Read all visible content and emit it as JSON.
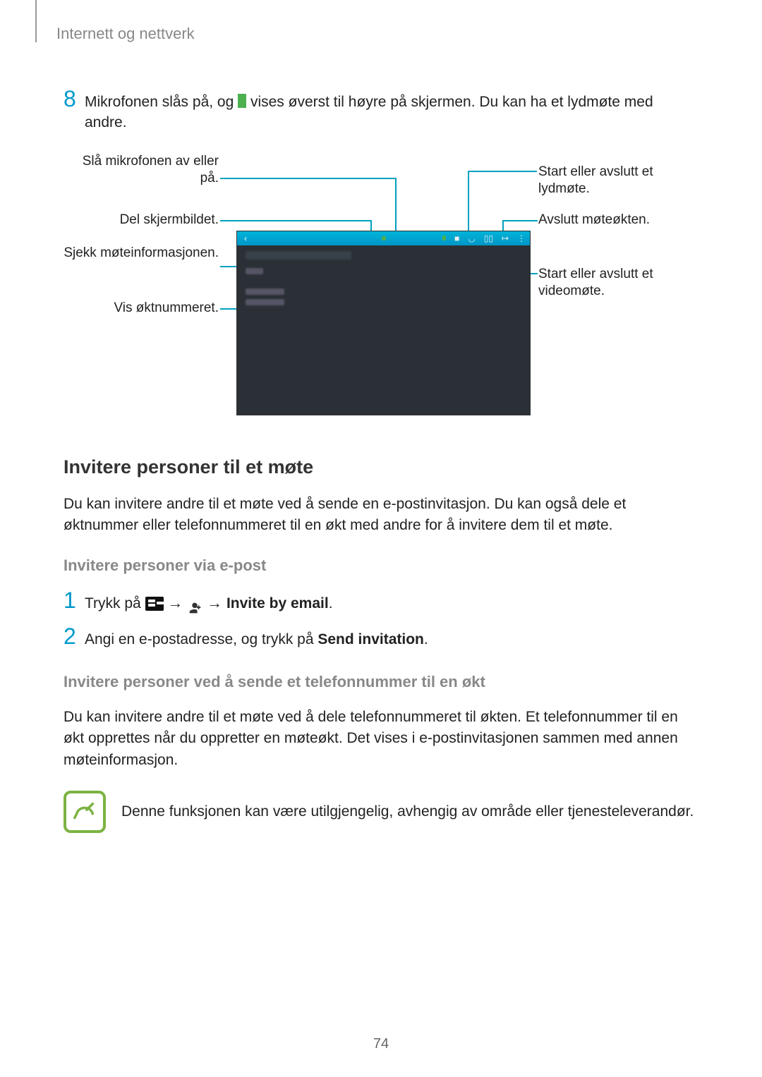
{
  "header": "Internett og nettverk",
  "step8": {
    "num": "8",
    "text_before": "Mikrofonen slås på, og ",
    "text_after": " vises øverst til høyre på skjermen. Du kan ha et lydmøte med andre."
  },
  "callouts": {
    "left1": "Slå mikrofonen av eller på.",
    "left2": "Del skjermbildet.",
    "left3": "Sjekk møteinformasjonen.",
    "left4": "Vis øktnummeret.",
    "right1": "Start eller avslutt et lydmøte.",
    "right2": "Avslutt møteøkten.",
    "right3": "Start eller avslutt et videomøte."
  },
  "h2": "Invitere personer til et møte",
  "para1": "Du kan invitere andre til et møte ved å sende en e-postinvitasjon. Du kan også dele et øktnummer eller telefonnummeret til en økt med andre for å invitere dem til et møte.",
  "h3a": "Invitere personer via e-post",
  "step1": {
    "num": "1",
    "prefix": "Trykk på ",
    "arrow": "→",
    "suffix_bold": "Invite by email",
    "period": "."
  },
  "step2": {
    "num": "2",
    "prefix": "Angi en e-postadresse, og trykk på ",
    "bold": "Send invitation",
    "period": "."
  },
  "h3b": "Invitere personer ved å sende et telefonnummer til en økt",
  "para2": "Du kan invitere andre til et møte ved å dele telefonnummeret til økten. Et telefonnummer til en økt opprettes når du oppretter en møteøkt. Det vises i e-postinvitasjonen sammen med annen møteinformasjon.",
  "note": "Denne funksjonen kan være utilgjengelig, avhengig av område eller tjenesteleverandør.",
  "page_number": "74"
}
